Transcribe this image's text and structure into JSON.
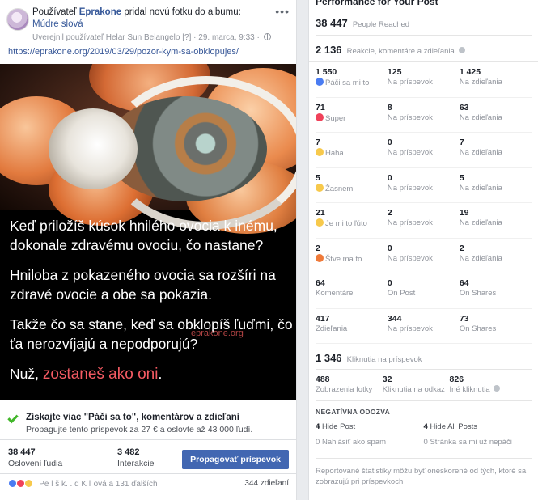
{
  "post": {
    "author_prefix": "Používateľ",
    "author": "Eprakone",
    "action_text": "pridal novú fotku do albumu:",
    "album": "Múdre slová",
    "published_by": "Uverejnil používateľ Helar Sun Belangelo",
    "published_marker": "[?]",
    "date": "29. marca, 9:33",
    "more_icon": "•••",
    "link": "https://eprakone.org/2019/03/29/pozor-kym-sa-obklopujes/",
    "image_lines": {
      "p1": "Keď priložíš kúsok hnilého ovocia k inému, dokonale zdravému ovociu, čo nastane?",
      "p2": "Hniloba z pokazeného ovocia sa rozšíri na zdravé ovocie a obe sa pokazia.",
      "p3": "Takže čo sa stane, keď sa obklopíš ľuďmi, čo ťa nerozvíjajú a nepodporujú?",
      "p4_prefix": "Nuž, ",
      "p4_highlight": "zostaneš ako oni",
      "p4_suffix": "."
    },
    "watermark": "eprakone.org",
    "promo_title": "Získajte viac \"Páči sa to\", komentárov a zdieľaní",
    "promo_sub": "Propagujte tento príspevok za 27 € a oslovte až 43 000 ľudí.",
    "reached_value": "38 447",
    "reached_label": "Oslovení ľudia",
    "engagement_value": "3 482",
    "engagement_label": "Interakcie",
    "boost_label": "Propagovať príspevok",
    "reaction_names": "Pe   l     š  k.   .  d      K    ľ ová a 131 ďalších",
    "shares": "344 zdieľaní"
  },
  "performance": {
    "title": "Performance for Your Post",
    "reached_value": "38 447",
    "reached_label": "People Reached",
    "reactions_value": "2 136",
    "reactions_label": "Reakcie, komentáre a zdieľania",
    "rows": [
      {
        "icon": "like-icon",
        "total": "1 550",
        "label": "Páči sa mi to",
        "on_post": "125",
        "on_post_label": "Na príspevok",
        "on_shares": "1 425",
        "on_shares_label": "Na zdieľania"
      },
      {
        "icon": "love-icon",
        "total": "71",
        "label": "Super",
        "on_post": "8",
        "on_post_label": "Na príspevok",
        "on_shares": "63",
        "on_shares_label": "Na zdieľania"
      },
      {
        "icon": "haha-icon",
        "total": "7",
        "label": "Haha",
        "on_post": "0",
        "on_post_label": "Na príspevok",
        "on_shares": "7",
        "on_shares_label": "Na zdieľania"
      },
      {
        "icon": "wow-icon",
        "total": "5",
        "label": "Žasnem",
        "on_post": "0",
        "on_post_label": "Na príspevok",
        "on_shares": "5",
        "on_shares_label": "Na zdieľania"
      },
      {
        "icon": "sad-icon",
        "total": "21",
        "label": "Je mi to ľúto",
        "on_post": "2",
        "on_post_label": "Na príspevok",
        "on_shares": "19",
        "on_shares_label": "Na zdieľania"
      },
      {
        "icon": "angry-icon",
        "total": "2",
        "label": "Štve ma to",
        "on_post": "0",
        "on_post_label": "Na príspevok",
        "on_shares": "2",
        "on_shares_label": "Na zdieľania"
      },
      {
        "icon": "",
        "total": "64",
        "label": "Komentáre",
        "on_post": "0",
        "on_post_label": "On Post",
        "on_shares": "64",
        "on_shares_label": "On Shares"
      },
      {
        "icon": "",
        "total": "417",
        "label": "Zdieľania",
        "on_post": "344",
        "on_post_label": "Na príspevok",
        "on_shares": "73",
        "on_shares_label": "On Shares"
      }
    ],
    "clicks_value": "1 346",
    "clicks_label": "Kliknutia na príspevok",
    "clicks": [
      {
        "value": "488",
        "label": "Zobrazenia fotky"
      },
      {
        "value": "32",
        "label": "Kliknutia na odkaz"
      },
      {
        "value": "826",
        "label": "Iné kliknutia"
      }
    ],
    "negative_title": "NEGATÍVNA ODOZVA",
    "negative": {
      "hide_post_value": "4",
      "hide_post_label": "Hide Post",
      "hide_all_value": "4",
      "hide_all_label": "Hide All Posts",
      "spam_value": "0",
      "spam_label": "Nahlásiť ako spam",
      "unlike_value": "0",
      "unlike_label": "Stránka sa mi už nepáči"
    },
    "disclaimer": "Reportované štatistiky môžu byť oneskorené od tých, ktoré sa zobrazujú pri príspevkoch"
  },
  "colors": {
    "facebook_blue": "#4267b2",
    "link_blue": "#385898",
    "highlight_red": "#f55b63",
    "promo_green": "#42b72a"
  }
}
